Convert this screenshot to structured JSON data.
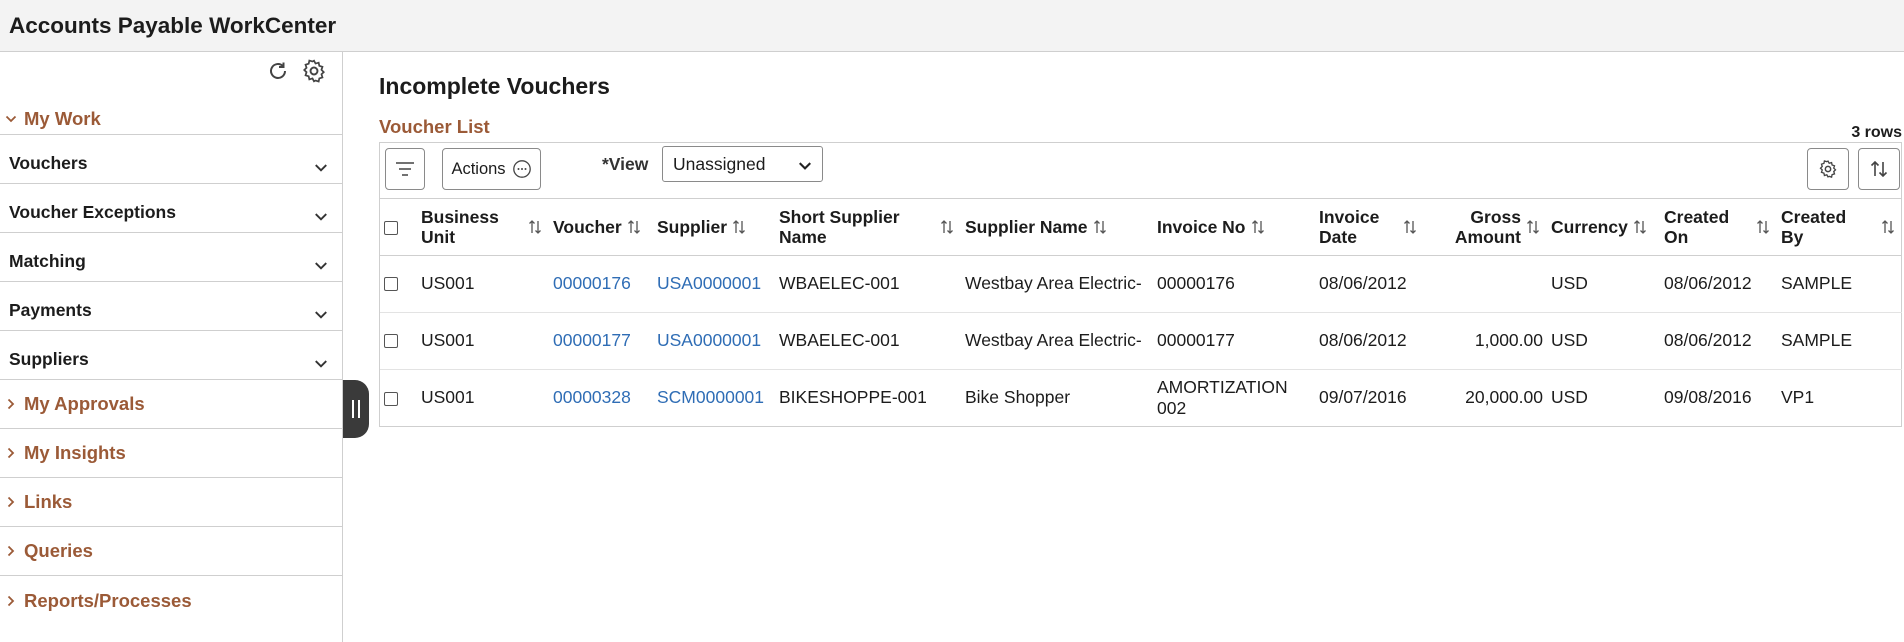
{
  "app": {
    "title": "Accounts Payable WorkCenter"
  },
  "sidebar": {
    "sections": [
      {
        "label": "My Work",
        "state": "expanded"
      },
      {
        "label": "My Approvals",
        "state": "collapsed"
      },
      {
        "label": "My Insights",
        "state": "collapsed"
      },
      {
        "label": "Links",
        "state": "collapsed"
      },
      {
        "label": "Queries",
        "state": "collapsed"
      },
      {
        "label": "Reports/Processes",
        "state": "collapsed"
      }
    ],
    "my_work_items": [
      "Vouchers",
      "Voucher Exceptions",
      "Matching",
      "Payments",
      "Suppliers"
    ]
  },
  "main": {
    "page_title": "Incomplete Vouchers",
    "grid_title": "Voucher List",
    "row_count": "3 rows",
    "toolbar": {
      "actions_label": "Actions",
      "view_label": "*View",
      "view_value": "Unassigned"
    },
    "columns": [
      "Business Unit",
      "Voucher",
      "Supplier",
      "Short Supplier Name",
      "Supplier Name",
      "Invoice No",
      "Invoice Date",
      "Gross Amount",
      "Currency",
      "Created On",
      "Created By"
    ],
    "rows": [
      [
        "US001",
        "00000176",
        "USA0000001",
        "WBAELEC-001",
        "Westbay Area Electric-",
        "00000176",
        "08/06/2012",
        "",
        "USD",
        "08/06/2012",
        "SAMPLE"
      ],
      [
        "US001",
        "00000177",
        "USA0000001",
        "WBAELEC-001",
        "Westbay Area Electric-",
        "00000177",
        "08/06/2012",
        "1,000.00",
        "USD",
        "08/06/2012",
        "SAMPLE"
      ],
      [
        "US001",
        "00000328",
        "SCM0000001",
        "BIKESHOPPE-001",
        "Bike Shopper",
        "AMORTIZATION 002",
        "09/07/2016",
        "20,000.00",
        "USD",
        "09/08/2016",
        "VP1"
      ]
    ]
  },
  "colors": {
    "section_accent": "#9b5a37",
    "link": "#2f6db5",
    "border": "#cfcfcf"
  }
}
